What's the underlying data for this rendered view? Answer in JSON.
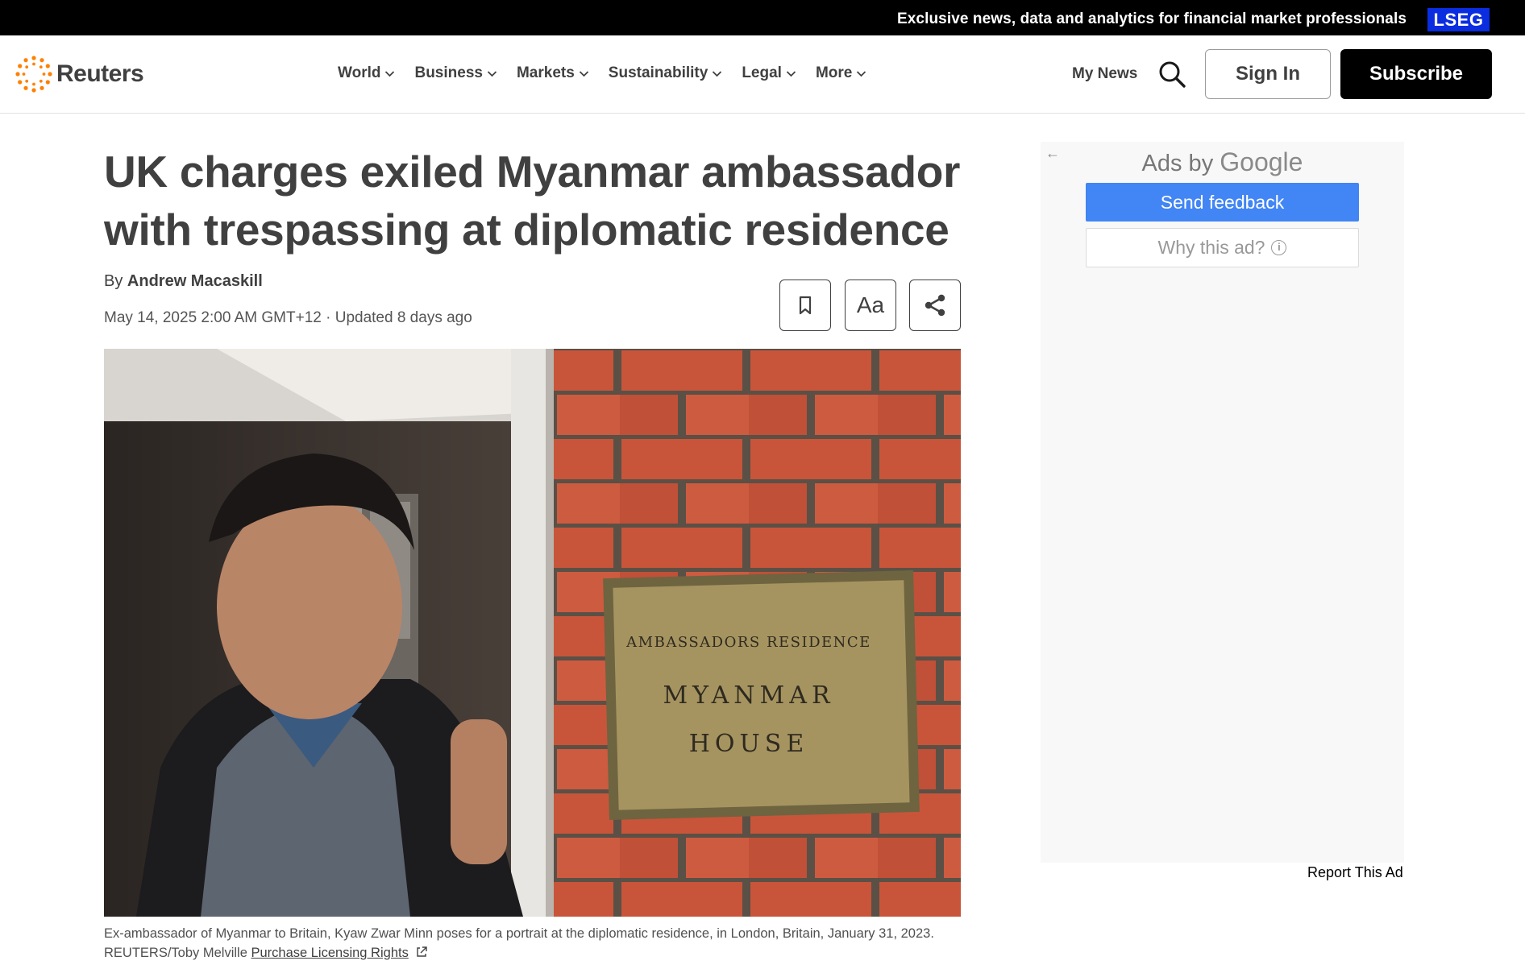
{
  "promo": {
    "text": "Exclusive news, data and analytics for financial market professionals",
    "brand": "LSEG"
  },
  "header": {
    "logo": "Reuters",
    "nav": [
      {
        "label": "World"
      },
      {
        "label": "Business"
      },
      {
        "label": "Markets"
      },
      {
        "label": "Sustainability"
      },
      {
        "label": "Legal"
      },
      {
        "label": "More"
      }
    ],
    "my_news": "My News",
    "sign_in": "Sign In",
    "subscribe": "Subscribe"
  },
  "article": {
    "headline": "UK charges exiled Myanmar ambassador with trespassing at diplomatic residence",
    "by_prefix": "By",
    "author": "Andrew Macaskill",
    "dateline": "May 14, 2025 2:00 AM GMT+12 · Updated 8 days ago",
    "tools": {
      "text_size_label": "Aa"
    },
    "photo": {
      "plaque_line1": "AMBASSADORS RESIDENCE",
      "plaque_line2": "MYANMAR",
      "plaque_line3": "HOUSE"
    },
    "caption": "Ex-ambassador of Myanmar to Britain, Kyaw Zwar Minn poses for a portrait at the diplomatic residence, in London, Britain, January 31, 2023.",
    "credit": "REUTERS/Toby Melville",
    "licensing_link": "Purchase Licensing Rights"
  },
  "ad": {
    "back_arrow": "←",
    "ads_by": "Ads by",
    "google": "Google",
    "send_feedback": "Send feedback",
    "why_this_ad": "Why this ad?",
    "info_glyph": "i",
    "report": "Report This Ad"
  },
  "colors": {
    "promo_bg": "#000000",
    "lseg_blue": "#0a2de0",
    "reuters_orange": "#ff8000",
    "text": "#404040",
    "feedback_blue": "#4285f4"
  }
}
